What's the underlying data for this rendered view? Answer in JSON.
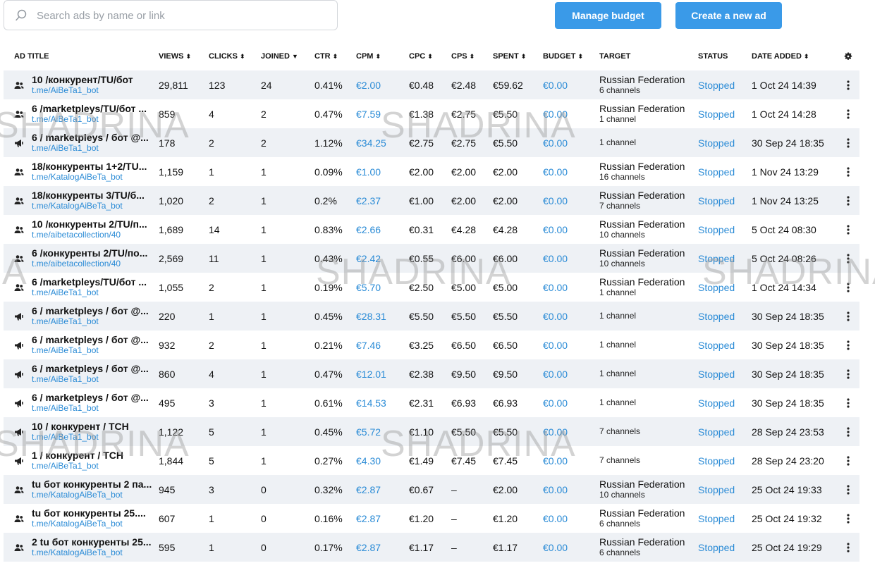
{
  "search": {
    "placeholder": "Search ads by name or link",
    "value": ""
  },
  "toolbar": {
    "manage_budget": "Manage budget",
    "create_ad": "Create a new ad"
  },
  "columns": {
    "ad_title": "AD TITLE",
    "views": "VIEWS",
    "clicks": "CLICKS",
    "joined": "JOINED",
    "ctr": "CTR",
    "cpm": "CPM",
    "cpc": "CPC",
    "cps": "CPS",
    "spent": "SPENT",
    "budget": "BUDGET",
    "target": "TARGET",
    "status": "STATUS",
    "date_added": "DATE ADDED"
  },
  "sort_icons": {
    "sortable": "⬍",
    "joined_desc": "▼"
  },
  "watermark": "SHADRINA",
  "rows": [
    {
      "icon": "users-icon",
      "title": "10 /конкурент/TU/бот",
      "link": "t.me/AiBeTa1_bot",
      "views": "29,811",
      "clicks": "123",
      "joined": "24",
      "ctr": "0.41%",
      "cpm": "€2.00",
      "cpc": "€0.48",
      "cps": "€2.48",
      "spent": "€59.62",
      "budget": "€0.00",
      "target_country": "Russian Federation",
      "target_channels": "6 channels",
      "status": "Stopped",
      "date": "1 Oct 24 14:39"
    },
    {
      "icon": "users-icon",
      "title": "6 /marketpleys/TU/бот ...",
      "link": "t.me/AiBeTa1_bot",
      "views": "859",
      "clicks": "4",
      "joined": "2",
      "ctr": "0.47%",
      "cpm": "€7.59",
      "cpc": "€1.38",
      "cps": "€2.75",
      "spent": "€5.50",
      "budget": "€0.00",
      "target_country": "Russian Federation",
      "target_channels": "1 channel",
      "status": "Stopped",
      "date": "1 Oct 24 14:28"
    },
    {
      "icon": "megaphone-icon",
      "title": "6 / marketpleys / бот @...",
      "link": "t.me/AiBeTa1_bot",
      "views": "178",
      "clicks": "2",
      "joined": "2",
      "ctr": "1.12%",
      "cpm": "€34.25",
      "cpc": "€2.75",
      "cps": "€2.75",
      "spent": "€5.50",
      "budget": "€0.00",
      "target_country": "",
      "target_channels": "1 channel",
      "status": "Stopped",
      "date": "30 Sep 24 18:35"
    },
    {
      "icon": "users-icon",
      "title": "18/конкуренты 1+2/TU...",
      "link": "t.me/KatalogAiBeTa_bot",
      "views": "1,159",
      "clicks": "1",
      "joined": "1",
      "ctr": "0.09%",
      "cpm": "€1.00",
      "cpc": "€2.00",
      "cps": "€2.00",
      "spent": "€2.00",
      "budget": "€0.00",
      "target_country": "Russian Federation",
      "target_channels": "16 channels",
      "status": "Stopped",
      "date": "1 Nov 24 13:29"
    },
    {
      "icon": "users-icon",
      "title": "18/конкуренты 3/TU/б...",
      "link": "t.me/KatalogAiBeTa_bot",
      "views": "1,020",
      "clicks": "2",
      "joined": "1",
      "ctr": "0.2%",
      "cpm": "€2.37",
      "cpc": "€1.00",
      "cps": "€2.00",
      "spent": "€2.00",
      "budget": "€0.00",
      "target_country": "Russian Federation",
      "target_channels": "7 channels",
      "status": "Stopped",
      "date": "1 Nov 24 13:25"
    },
    {
      "icon": "users-icon",
      "title": "10 /конкуренты 2/TU/п...",
      "link": "t.me/aibetacollection/40",
      "views": "1,689",
      "clicks": "14",
      "joined": "1",
      "ctr": "0.83%",
      "cpm": "€2.66",
      "cpc": "€0.31",
      "cps": "€4.28",
      "spent": "€4.28",
      "budget": "€0.00",
      "target_country": "Russian Federation",
      "target_channels": "10 channels",
      "status": "Stopped",
      "date": "5 Oct 24 08:30"
    },
    {
      "icon": "users-icon",
      "title": "6 /конкуренты 2/TU/по...",
      "link": "t.me/aibetacollection/40",
      "views": "2,569",
      "clicks": "11",
      "joined": "1",
      "ctr": "0.43%",
      "cpm": "€2.42",
      "cpc": "€0.55",
      "cps": "€6.00",
      "spent": "€6.00",
      "budget": "€0.00",
      "target_country": "Russian Federation",
      "target_channels": "10 channels",
      "status": "Stopped",
      "date": "5 Oct 24 08:26"
    },
    {
      "icon": "users-icon",
      "title": "6 /marketpleys/TU/бот ...",
      "link": "t.me/AiBeTa1_bot",
      "views": "1,055",
      "clicks": "2",
      "joined": "1",
      "ctr": "0.19%",
      "cpm": "€5.70",
      "cpc": "€2.50",
      "cps": "€5.00",
      "spent": "€5.00",
      "budget": "€0.00",
      "target_country": "Russian Federation",
      "target_channels": "1 channel",
      "status": "Stopped",
      "date": "1 Oct 24 14:34"
    },
    {
      "icon": "megaphone-icon",
      "title": "6 / marketpleys / бот @...",
      "link": "t.me/AiBeTa1_bot",
      "views": "220",
      "clicks": "1",
      "joined": "1",
      "ctr": "0.45%",
      "cpm": "€28.31",
      "cpc": "€5.50",
      "cps": "€5.50",
      "spent": "€5.50",
      "budget": "€0.00",
      "target_country": "",
      "target_channels": "1 channel",
      "status": "Stopped",
      "date": "30 Sep 24 18:35"
    },
    {
      "icon": "megaphone-icon",
      "title": "6 / marketpleys / бот @...",
      "link": "t.me/AiBeTa1_bot",
      "views": "932",
      "clicks": "2",
      "joined": "1",
      "ctr": "0.21%",
      "cpm": "€7.46",
      "cpc": "€3.25",
      "cps": "€6.50",
      "spent": "€6.50",
      "budget": "€0.00",
      "target_country": "",
      "target_channels": "1 channel",
      "status": "Stopped",
      "date": "30 Sep 24 18:35"
    },
    {
      "icon": "megaphone-icon",
      "title": "6 / marketpleys / бот @...",
      "link": "t.me/AiBeTa1_bot",
      "views": "860",
      "clicks": "4",
      "joined": "1",
      "ctr": "0.47%",
      "cpm": "€12.01",
      "cpc": "€2.38",
      "cps": "€9.50",
      "spent": "€9.50",
      "budget": "€0.00",
      "target_country": "",
      "target_channels": "1 channel",
      "status": "Stopped",
      "date": "30 Sep 24 18:35"
    },
    {
      "icon": "megaphone-icon",
      "title": "6 / marketpleys / бот @...",
      "link": "t.me/AiBeTa1_bot",
      "views": "495",
      "clicks": "3",
      "joined": "1",
      "ctr": "0.61%",
      "cpm": "€14.53",
      "cpc": "€2.31",
      "cps": "€6.93",
      "spent": "€6.93",
      "budget": "€0.00",
      "target_country": "",
      "target_channels": "1 channel",
      "status": "Stopped",
      "date": "30 Sep 24 18:35"
    },
    {
      "icon": "megaphone-icon",
      "title": "10 / конкурент / ТСН",
      "link": "t.me/AiBeTa1_bot",
      "views": "1,122",
      "clicks": "5",
      "joined": "1",
      "ctr": "0.45%",
      "cpm": "€5.72",
      "cpc": "€1.10",
      "cps": "€5.50",
      "spent": "€5.50",
      "budget": "€0.00",
      "target_country": "",
      "target_channels": "7 channels",
      "status": "Stopped",
      "date": "28 Sep 24 23:53"
    },
    {
      "icon": "megaphone-icon",
      "title": "1 / конкурент / ТСН",
      "link": "t.me/AiBeTa1_bot",
      "views": "1,844",
      "clicks": "5",
      "joined": "1",
      "ctr": "0.27%",
      "cpm": "€4.30",
      "cpc": "€1.49",
      "cps": "€7.45",
      "spent": "€7.45",
      "budget": "€0.00",
      "target_country": "",
      "target_channels": "7 channels",
      "status": "Stopped",
      "date": "28 Sep 24 23:20"
    },
    {
      "icon": "users-icon",
      "title": "tu бот конкуренты 2 па...",
      "link": "t.me/KatalogAiBeTa_bot",
      "views": "945",
      "clicks": "3",
      "joined": "0",
      "ctr": "0.32%",
      "cpm": "€2.87",
      "cpc": "€0.67",
      "cps": "–",
      "spent": "€2.00",
      "budget": "€0.00",
      "target_country": "Russian Federation",
      "target_channels": "10 channels",
      "status": "Stopped",
      "date": "25 Oct 24 19:33"
    },
    {
      "icon": "users-icon",
      "title": "tu бот конкуренты 25....",
      "link": "t.me/KatalogAiBeTa_bot",
      "views": "607",
      "clicks": "1",
      "joined": "0",
      "ctr": "0.16%",
      "cpm": "€2.87",
      "cpc": "€1.20",
      "cps": "–",
      "spent": "€1.20",
      "budget": "€0.00",
      "target_country": "Russian Federation",
      "target_channels": "6 channels",
      "status": "Stopped",
      "date": "25 Oct 24 19:32"
    },
    {
      "icon": "users-icon",
      "title": "2 tu бот конкуренты 25...",
      "link": "t.me/KatalogAiBeTa_bot",
      "views": "595",
      "clicks": "1",
      "joined": "0",
      "ctr": "0.17%",
      "cpm": "€2.87",
      "cpc": "€1.17",
      "cps": "–",
      "spent": "€1.17",
      "budget": "€0.00",
      "target_country": "Russian Federation",
      "target_channels": "6 channels",
      "status": "Stopped",
      "date": "25 Oct 24 19:29"
    }
  ],
  "colors": {
    "accent": "#3a9ae8",
    "link": "#2a8bd6",
    "row_alt": "#eef1f5"
  }
}
